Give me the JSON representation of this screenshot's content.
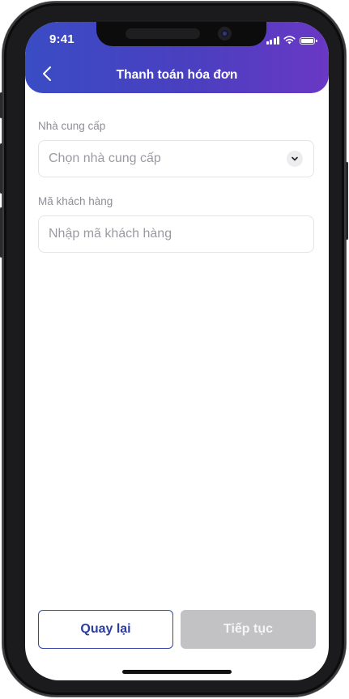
{
  "status_bar": {
    "time": "9:41",
    "icons": [
      "cellular-signal-icon",
      "wifi-icon",
      "battery-icon"
    ]
  },
  "header": {
    "title": "Thanh toán hóa đơn",
    "back_icon": "chevron-left-icon",
    "gradient_colors": [
      "#3a4cc4",
      "#6a38c4"
    ]
  },
  "form": {
    "provider": {
      "label": "Nhà cung cấp",
      "placeholder": "Chọn nhà cung cấp",
      "icon": "chevron-down-icon"
    },
    "customer_code": {
      "label": "Mã khách hàng",
      "placeholder": "Nhập mã khách hàng"
    }
  },
  "actions": {
    "back_label": "Quay lại",
    "continue_label": "Tiếp tục",
    "continue_enabled": false,
    "accent_color": "#2d3d9e"
  }
}
